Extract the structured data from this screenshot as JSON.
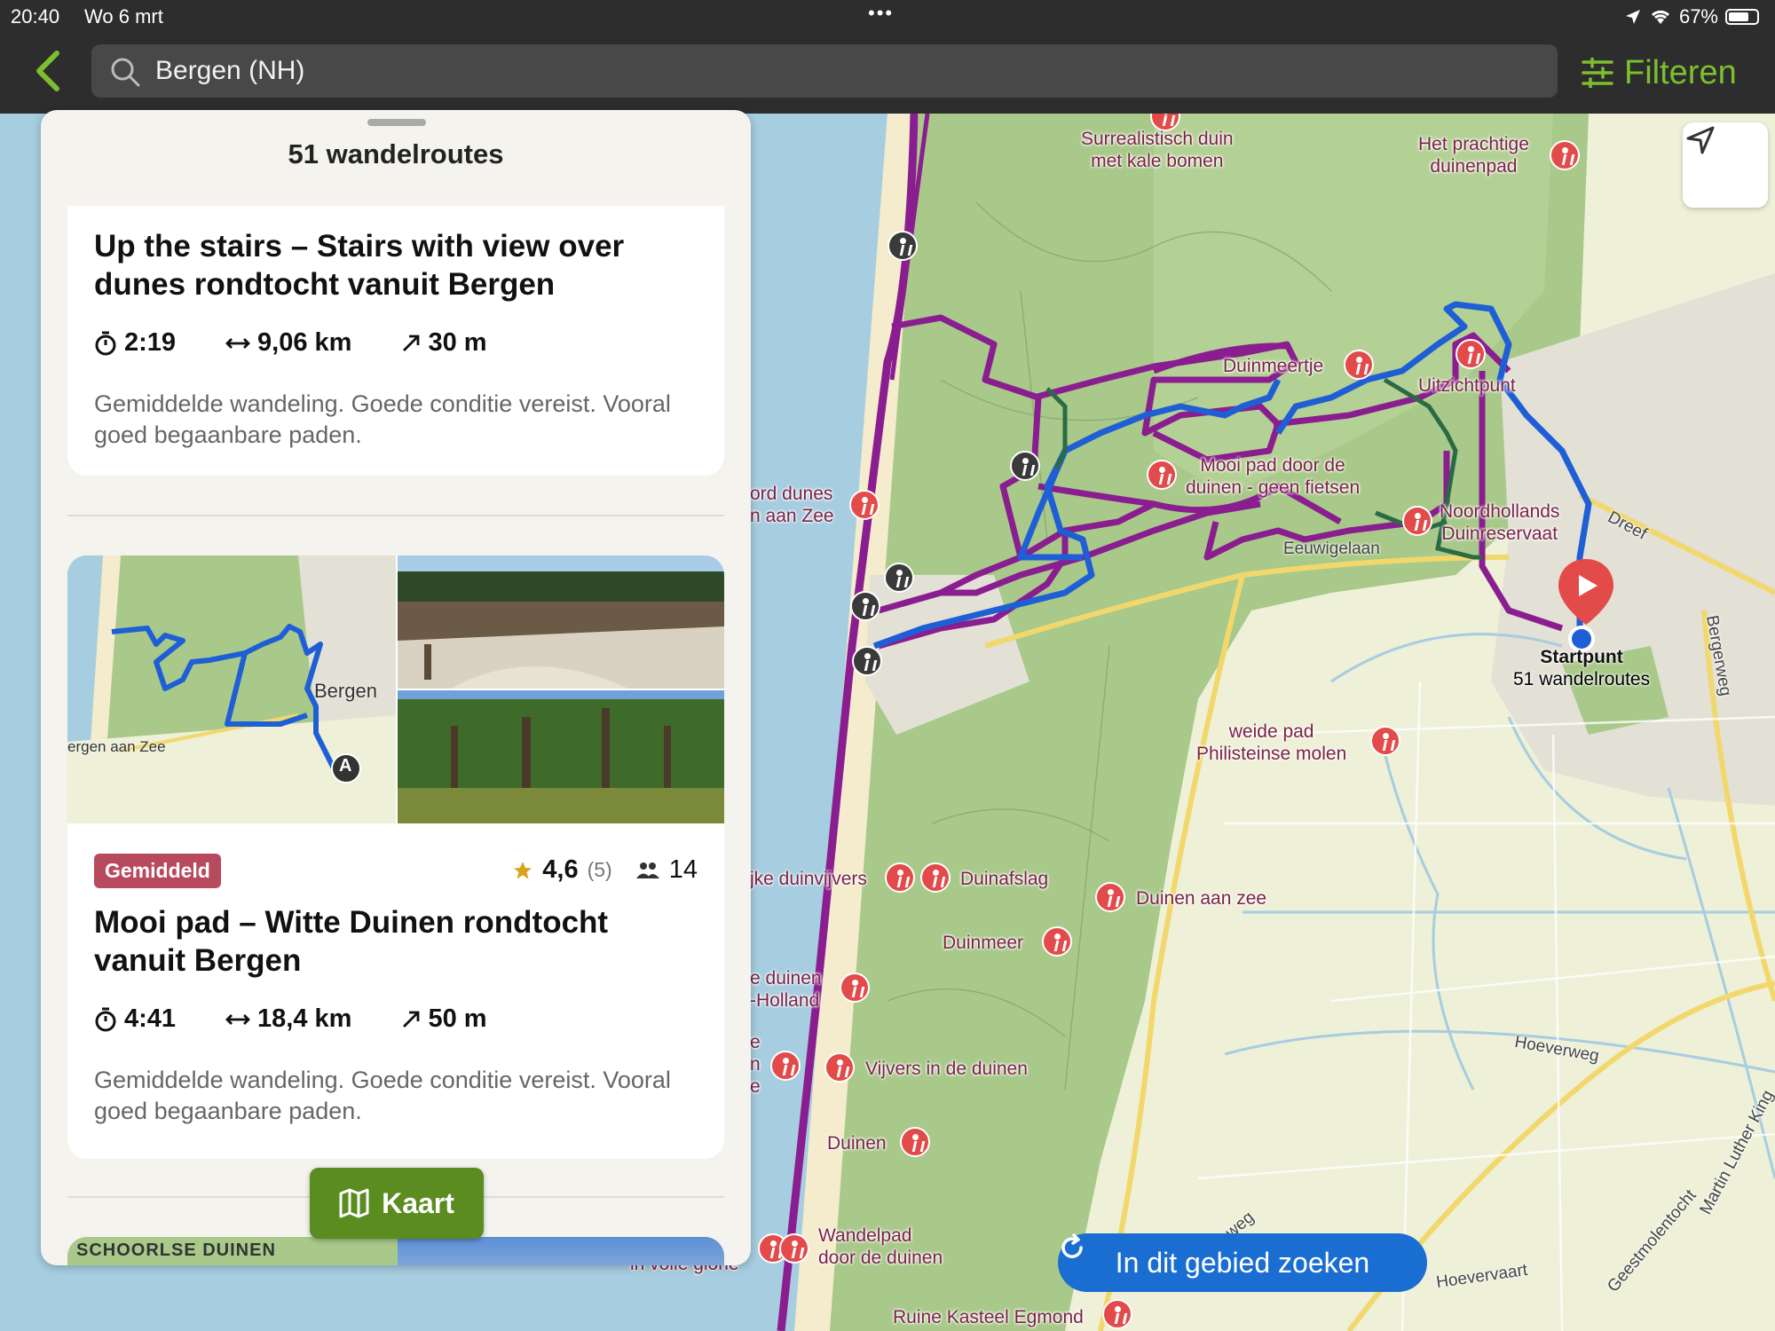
{
  "status_bar": {
    "time": "20:40",
    "date": "Wo 6 mrt",
    "battery": "67%"
  },
  "nav": {
    "search_value": "Bergen (NH)",
    "filter_label": "Filteren"
  },
  "panel": {
    "title": "51 wandelroutes",
    "routes": [
      {
        "title": "Up the stairs – Stairs with view over dunes rondtocht vanuit Bergen",
        "duration": "2:19",
        "distance": "9,06 km",
        "ascent": "30 m",
        "description": "Gemiddelde wandeling. Goede conditie vereist. Vooral goed begaanbare paden."
      },
      {
        "title": "Mooi pad – Witte Duinen rondtocht vanuit Bergen",
        "difficulty": "Gemiddeld",
        "rating": "4,6",
        "rating_count": "(5)",
        "walkers": "14",
        "duration": "4:41",
        "distance": "18,4 km",
        "ascent": "50 m",
        "description": "Gemiddelde wandeling. Goede conditie vereist. Vooral goed begaanbare paden.",
        "thumb_labels": {
          "town": "Bergen",
          "coast": "ergen aan Zee",
          "start": "A"
        }
      }
    ],
    "next_card_label": "SCHOORLSE DUINEN",
    "map_button": "Kaart"
  },
  "map": {
    "labels": [
      {
        "text": "Surrealistisch duin\nmet kale bomen"
      },
      {
        "text": "Het prachtige\nduinenpad"
      },
      {
        "text": "Duinmeertje"
      },
      {
        "text": "Uitzichtpunt"
      },
      {
        "text": "Mooi pad door de\nduinen - geen fietsen"
      },
      {
        "text": "Noordhollands\nDuinreservaat"
      },
      {
        "text": "ord dunes\nn aan Zee"
      },
      {
        "text": "weide pad\nPhilisteinse molen"
      },
      {
        "text": "jke duinvijvers"
      },
      {
        "text": "Duinafslag"
      },
      {
        "text": "Duinen aan zee"
      },
      {
        "text": "Duinmeer"
      },
      {
        "text": "e duinen\n-Holland"
      },
      {
        "text": "Vijvers in de duinen"
      },
      {
        "text": "Duinen"
      },
      {
        "text": "Wandelpad\ndoor de duinen"
      },
      {
        "text": "Ruine Kasteel Egmond"
      },
      {
        "text": "e\nn\ne"
      },
      {
        "text": "in volle glorie"
      }
    ],
    "road_labels": [
      "Eeuwigelaan",
      "Dreef",
      "Bergerweg",
      "Hoeverweg",
      "Hoevervaart",
      "Geestmolentocht",
      "Martin Luther King",
      "weg"
    ],
    "start_title": "Startpunt",
    "start_sub": "51 wandelroutes",
    "search_area_button": "In dit gebied zoeken"
  },
  "colors": {
    "accent": "#7cbf2f",
    "route_purple": "#8a1d8f",
    "route_blue": "#1f5fd6",
    "pin_red": "#e34a4a",
    "button_green": "#5a8c1f",
    "badge": "#b84a5f"
  }
}
